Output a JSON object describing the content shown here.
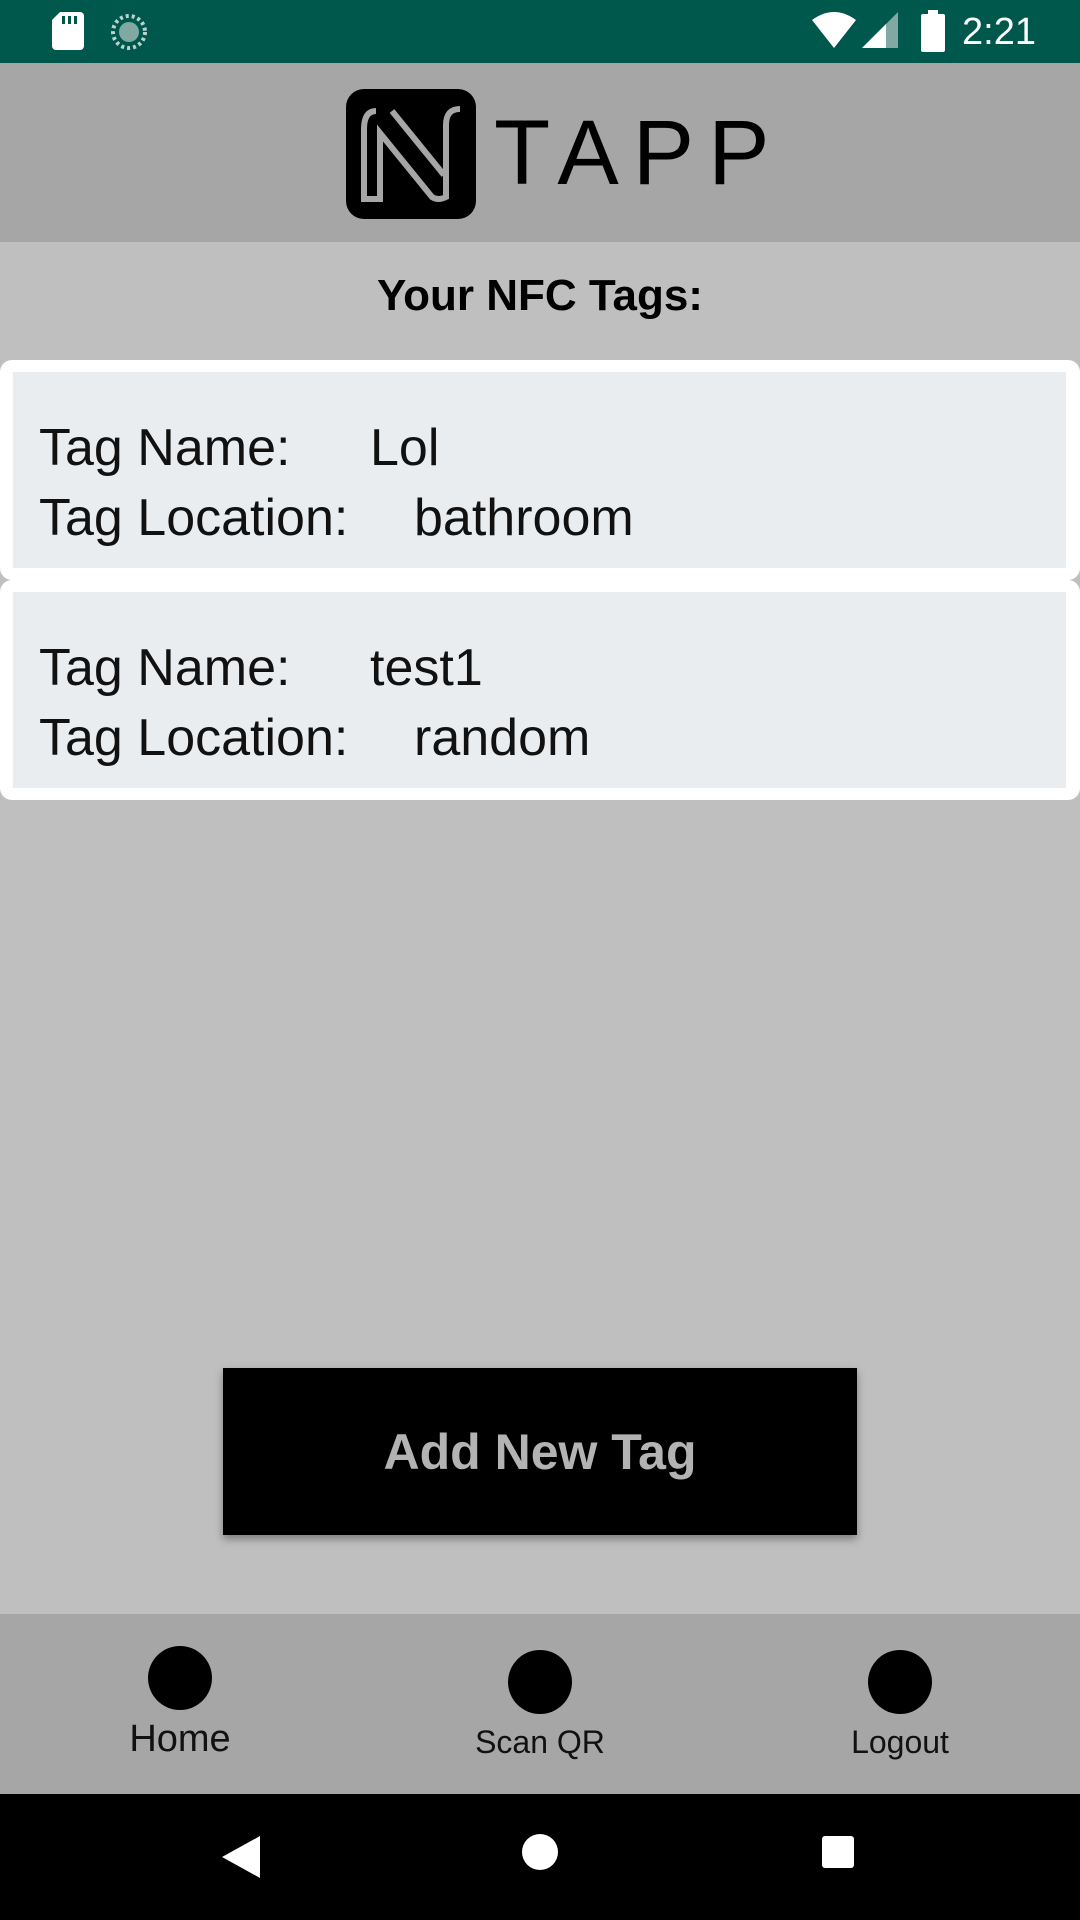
{
  "status_bar": {
    "time": "2:21",
    "icons": [
      "sd-card-icon",
      "sync-icon",
      "wifi-icon",
      "signal-icon",
      "battery-icon"
    ],
    "background": "#00574b"
  },
  "header": {
    "logo_text": "TAPP",
    "logo_icon": "nfc-n-logo-icon",
    "background": "#a6a6a6"
  },
  "page": {
    "title": "Your NFC Tags:"
  },
  "tags": [
    {
      "name_label": "Tag Name:",
      "name_value": "Lol",
      "location_label": "Tag Location:",
      "location_value": "bathroom"
    },
    {
      "name_label": "Tag Name:",
      "name_value": "test1",
      "location_label": "Tag Location:",
      "location_value": "random"
    }
  ],
  "actions": {
    "add_label": "Add New Tag"
  },
  "bottom_nav": {
    "items": [
      {
        "label": "Home"
      },
      {
        "label": "Scan QR"
      },
      {
        "label": "Logout"
      }
    ]
  },
  "system_nav": {
    "icons": [
      "back-icon",
      "home-icon",
      "recents-icon"
    ]
  }
}
